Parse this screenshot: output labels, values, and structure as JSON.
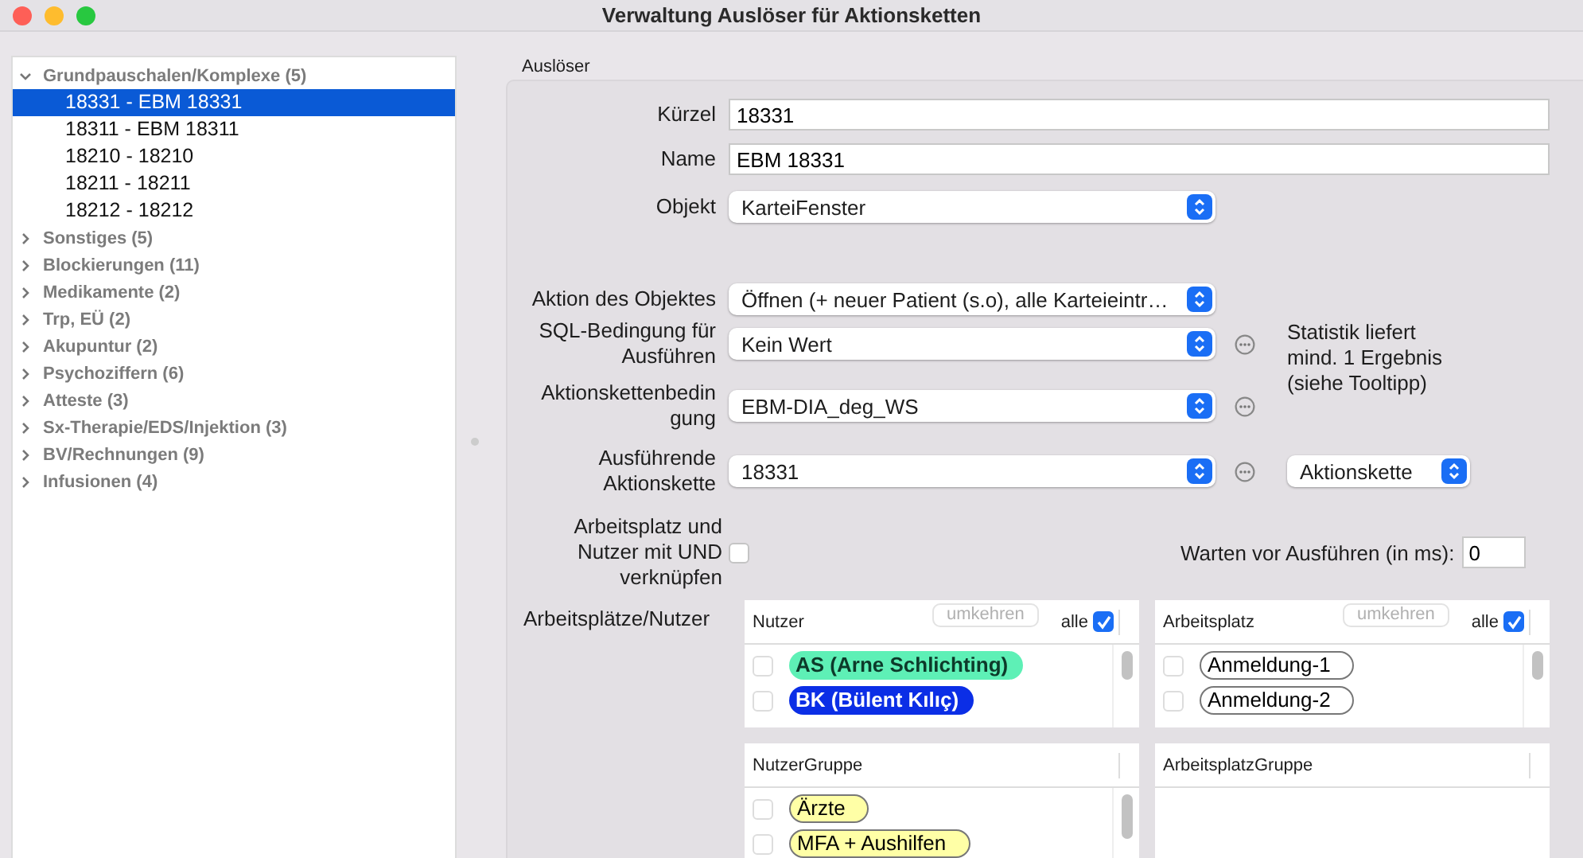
{
  "window": {
    "title": "Verwaltung Auslöser für Aktionsketten"
  },
  "sidebar": {
    "groups": [
      {
        "label": "Grundpauschalen/Komplexe (5)",
        "expanded": true,
        "children": [
          {
            "label": "18331 - EBM 18331",
            "selected": true
          },
          {
            "label": "18311 - EBM 18311",
            "selected": false
          },
          {
            "label": "18210 - 18210",
            "selected": false
          },
          {
            "label": "18211 - 18211",
            "selected": false
          },
          {
            "label": "18212 - 18212",
            "selected": false
          }
        ]
      },
      {
        "label": "Sonstiges (5)",
        "expanded": false
      },
      {
        "label": "Blockierungen (11)",
        "expanded": false
      },
      {
        "label": "Medikamente (2)",
        "expanded": false
      },
      {
        "label": "Trp, EÜ (2)",
        "expanded": false
      },
      {
        "label": "Akupuntur (2)",
        "expanded": false
      },
      {
        "label": "Psychoziffern (6)",
        "expanded": false
      },
      {
        "label": "Atteste (3)",
        "expanded": false
      },
      {
        "label": "Sx-Therapie/EDS/Injektion (3)",
        "expanded": false
      },
      {
        "label": "BV/Rechnungen (9)",
        "expanded": false
      },
      {
        "label": "Infusionen (4)",
        "expanded": false
      }
    ]
  },
  "trigger": {
    "legend": "Auslöser",
    "rows": [
      {
        "kind": "text",
        "label": "Kürzel",
        "value": "18331"
      },
      {
        "kind": "text",
        "label": "Name",
        "value": "EBM 18331"
      },
      {
        "kind": "select",
        "label": "Objekt",
        "value": "KarteiFenster",
        "more": false
      },
      {
        "kind": "select",
        "label": "Aktion des Objektes",
        "value": "Öffnen (+ neuer Patient (s.o), alle Karteieintr…",
        "more": false
      },
      {
        "kind": "select",
        "label": "SQL-Bedingung für Ausführen",
        "value": "Kein Wert",
        "more": true,
        "note": "Statistik liefert mind. 1 Ergebnis (siehe Tooltipp)"
      },
      {
        "kind": "select",
        "label": "Aktionskettenbedin gung",
        "value": "EBM-DIA_deg_WS",
        "more": true
      },
      {
        "kind": "select",
        "label": "Ausführende Aktionskette",
        "value": "18331",
        "more": true,
        "extra_select": "Aktionskette"
      }
    ],
    "combine": {
      "label": "Arbeitsplatz und Nutzer mit UND verknüpfen",
      "checked": false,
      "wait_label": "Warten vor Ausführen (in ms):",
      "wait_value": "0"
    },
    "lists_label": "Arbeitsplätze/Nutzer",
    "lists": [
      {
        "title": "Nutzer",
        "invert": "umkehren",
        "all_label": "alle",
        "all_checked": true,
        "items": [
          {
            "label": "AS (Arne Schlichting)",
            "checked": false,
            "color": "#5ef0b6"
          },
          {
            "label": "BK (Bülent Kılıç)",
            "checked": false,
            "color": "#0b2ee6"
          }
        ]
      },
      {
        "title": "Arbeitsplatz",
        "invert": "umkehren",
        "all_label": "alle",
        "all_checked": true,
        "items": [
          {
            "label": "Anmeldung-1",
            "checked": false,
            "color": "#ffffff"
          },
          {
            "label": "Anmeldung-2",
            "checked": false,
            "color": "#ffffff"
          }
        ]
      },
      {
        "title": "NutzerGruppe",
        "items": [
          {
            "label": "Ärzte",
            "checked": false,
            "color": "#ffffa6"
          },
          {
            "label": "MFA + Aushilfen",
            "checked": false,
            "color": "#ffffa6"
          }
        ]
      },
      {
        "title": "ArbeitsplatzGruppe"
      }
    ]
  }
}
